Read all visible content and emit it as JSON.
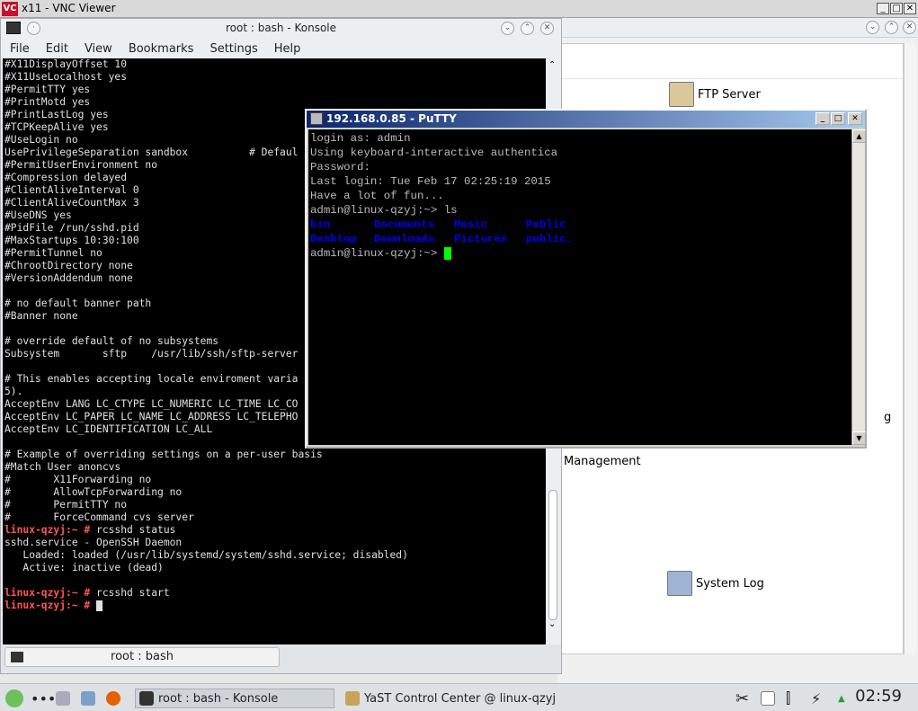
{
  "vnc": {
    "title": "x11 - VNC Viewer",
    "logo": "VC"
  },
  "konsole": {
    "title": "root : bash - Konsole",
    "menu": [
      "File",
      "Edit",
      "View",
      "Bookmarks",
      "Settings",
      "Help"
    ],
    "tab_label": "root : bash",
    "lines": [
      {
        "text": "#X11DisplayOffset 10"
      },
      {
        "text": "#X11UseLocalhost yes"
      },
      {
        "text": "#PermitTTY yes"
      },
      {
        "text": "#PrintMotd yes"
      },
      {
        "text": "#PrintLastLog yes"
      },
      {
        "text": "#TCPKeepAlive yes"
      },
      {
        "text": "#UseLogin no"
      },
      {
        "text": "UsePrivilegeSeparation sandbox          # Defaul"
      },
      {
        "text": "#PermitUserEnvironment no"
      },
      {
        "text": "#Compression delayed"
      },
      {
        "text": "#ClientAliveInterval 0"
      },
      {
        "text": "#ClientAliveCountMax 3"
      },
      {
        "text": "#UseDNS yes"
      },
      {
        "text": "#PidFile /run/sshd.pid"
      },
      {
        "text": "#MaxStartups 10:30:100"
      },
      {
        "text": "#PermitTunnel no"
      },
      {
        "text": "#ChrootDirectory none"
      },
      {
        "text": "#VersionAddendum none"
      },
      {
        "text": ""
      },
      {
        "text": "# no default banner path"
      },
      {
        "text": "#Banner none"
      },
      {
        "text": ""
      },
      {
        "text": "# override default of no subsystems"
      },
      {
        "text": "Subsystem       sftp    /usr/lib/ssh/sftp-server"
      },
      {
        "text": ""
      },
      {
        "text": "# This enables accepting locale enviroment varia"
      },
      {
        "text": "5)."
      },
      {
        "text": "AcceptEnv LANG LC_CTYPE LC_NUMERIC LC_TIME LC_CO"
      },
      {
        "text": "AcceptEnv LC_PAPER LC_NAME LC_ADDRESS LC_TELEPHO"
      },
      {
        "text": "AcceptEnv LC_IDENTIFICATION LC_ALL"
      },
      {
        "text": ""
      },
      {
        "text": "# Example of overriding settings on a per-user basis"
      },
      {
        "text": "#Match User anoncvs"
      },
      {
        "text": "#       X11Forwarding no"
      },
      {
        "text": "#       AllowTcpForwarding no"
      },
      {
        "text": "#       PermitTTY no"
      },
      {
        "text": "#       ForceCommand cvs server"
      },
      {
        "prompt": "linux-qzyj:~ #",
        "text": " rcsshd status"
      },
      {
        "text": "sshd.service - OpenSSH Daemon"
      },
      {
        "text": "   Loaded: loaded (/usr/lib/systemd/system/sshd.service; disabled)"
      },
      {
        "text": "   Active: inactive (dead)"
      },
      {
        "text": ""
      },
      {
        "prompt": "linux-qzyj:~ #",
        "text": " rcsshd start"
      },
      {
        "prompt": "linux-qzyj:~ #",
        "text": " ",
        "cursor": true
      }
    ]
  },
  "putty": {
    "title": "192.168.0.85 - PuTTY",
    "lines": [
      {
        "text": "login as: admin"
      },
      {
        "text": "Using keyboard-interactive authentica"
      },
      {
        "text": "Password:"
      },
      {
        "text": "Last login: Tue Feb 17 02:25:19 2015"
      },
      {
        "text": "Have a lot of fun..."
      },
      {
        "text": "admin@linux-qzyj:~> ls"
      },
      {
        "dirs": [
          "bin",
          "Documents",
          "Music",
          "Public"
        ]
      },
      {
        "dirs": [
          "Desktop",
          "Downloads",
          "Pictures",
          "public_"
        ]
      },
      {
        "text": "admin@linux-qzyj:~> ",
        "cursor": true
      }
    ]
  },
  "yast": {
    "items": [
      "FTP Server",
      "Management",
      "System Log"
    ],
    "partial": "g"
  },
  "taskbar": {
    "konsole_task": "root : bash - Konsole",
    "yast_task": "YaST Control Center @ linux-qzyj",
    "clock": "02:59"
  }
}
